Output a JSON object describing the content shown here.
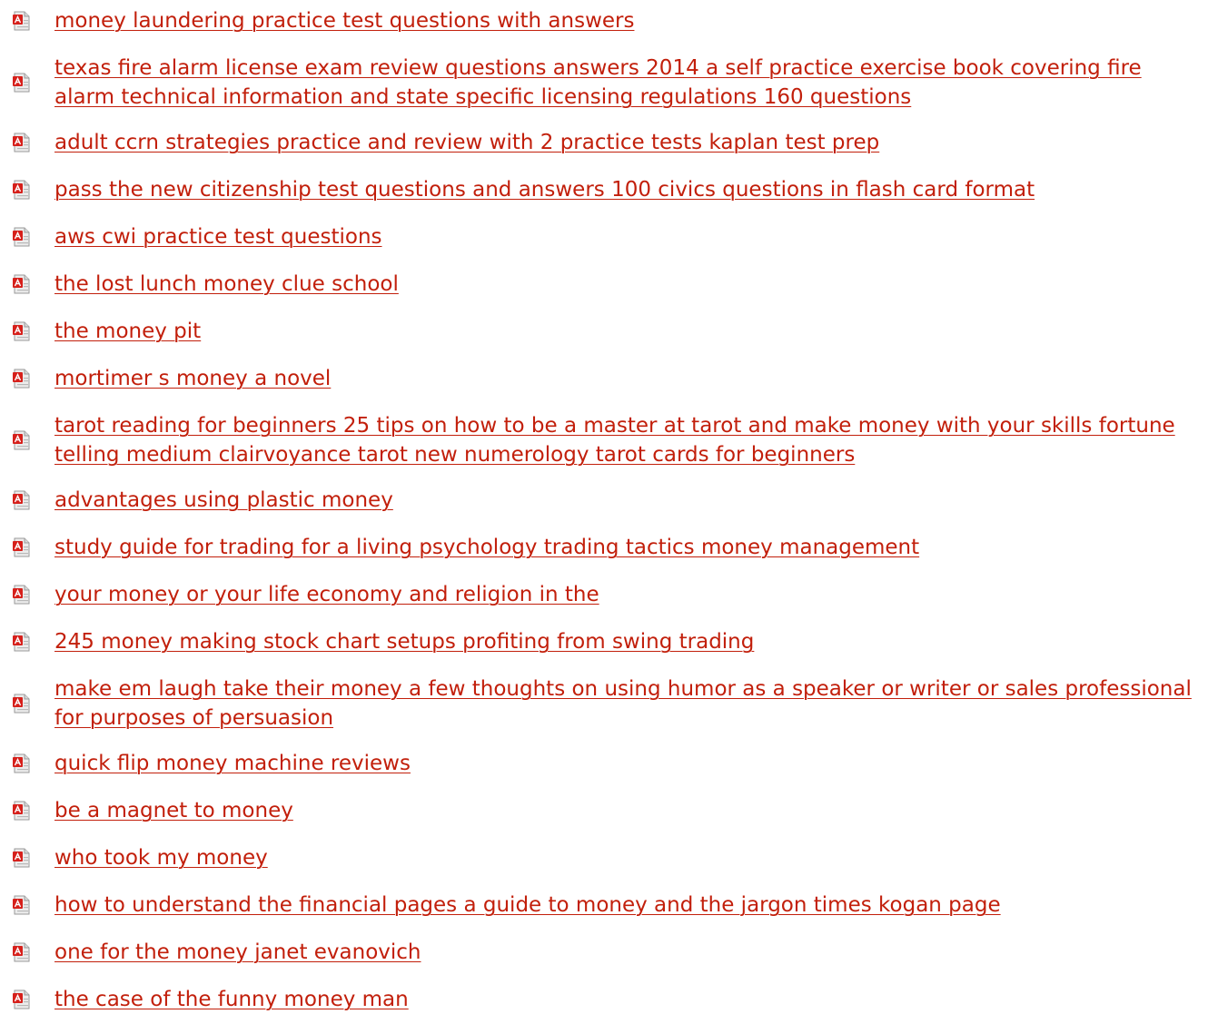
{
  "links": [
    {
      "label": "money laundering practice test questions with answers"
    },
    {
      "label": "texas fire alarm license exam review questions answers 2014 a self practice exercise book covering fire alarm technical information and state specific licensing regulations 160 questions"
    },
    {
      "label": "adult ccrn strategies practice and review with 2 practice tests kaplan test prep"
    },
    {
      "label": "pass the new citizenship test questions and answers 100 civics questions in flash card format"
    },
    {
      "label": "aws cwi practice test questions"
    },
    {
      "label": "the lost lunch money clue school"
    },
    {
      "label": "the money pit"
    },
    {
      "label": "mortimer s money a novel"
    },
    {
      "label": "tarot reading for beginners 25 tips on how to be a master at tarot and make money with your skills fortune telling medium clairvoyance tarot new numerology tarot cards for beginners"
    },
    {
      "label": "advantages using plastic money"
    },
    {
      "label": "study guide for trading for a living psychology trading tactics money management"
    },
    {
      "label": "your money or your life economy and religion in the"
    },
    {
      "label": "245 money making stock chart setups profiting from swing trading"
    },
    {
      "label": "make em laugh take their money a few thoughts on using humor as a speaker or writer or sales professional for purposes of persuasion"
    },
    {
      "label": "quick flip money machine reviews"
    },
    {
      "label": "be a magnet to money"
    },
    {
      "label": "who took my money"
    },
    {
      "label": "how to understand the financial pages a guide to money and the jargon times kogan page"
    },
    {
      "label": "one for the money janet evanovich"
    },
    {
      "label": "the case of the funny money man"
    }
  ],
  "colors": {
    "link": "#c21f0b",
    "background": "#ffffff"
  },
  "icons": {
    "item": "pdf-file-icon"
  }
}
